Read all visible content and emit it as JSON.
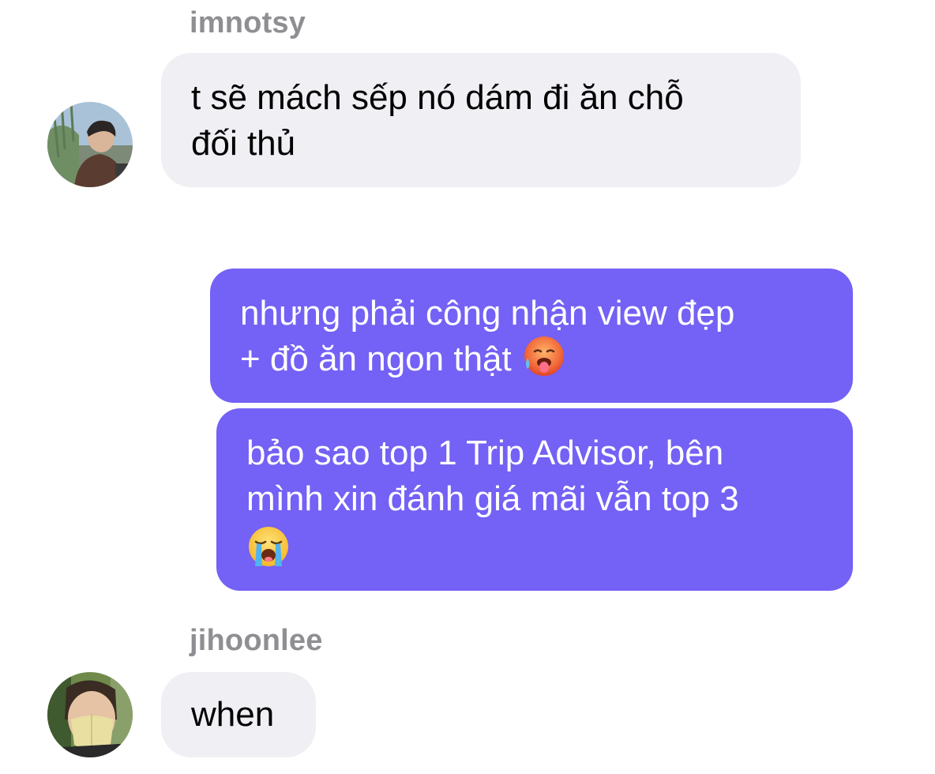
{
  "conversation": {
    "messages": [
      {
        "sender": "imnotsy",
        "direction": "incoming",
        "lines": [
          "t sẽ mách sếp nó dám đi ăn chỗ",
          "đối thủ"
        ]
      },
      {
        "direction": "outgoing",
        "lines": [
          "nhưng phải công nhận view đẹp",
          "+ đồ ăn ngon thật"
        ],
        "emoji": "hot-face-emoji"
      },
      {
        "direction": "outgoing",
        "lines": [
          "bảo sao top 1 Trip Advisor, bên",
          "mình xin đánh giá mãi vẫn top 3"
        ],
        "emoji": "loudly-crying-face-emoji"
      },
      {
        "sender": "jihoonlee",
        "direction": "incoming",
        "lines": [
          "when"
        ]
      }
    ]
  },
  "colors": {
    "outgoing_bubble": "#7461f5",
    "incoming_bubble": "#efeff4",
    "sender_name": "#8e8e93"
  }
}
